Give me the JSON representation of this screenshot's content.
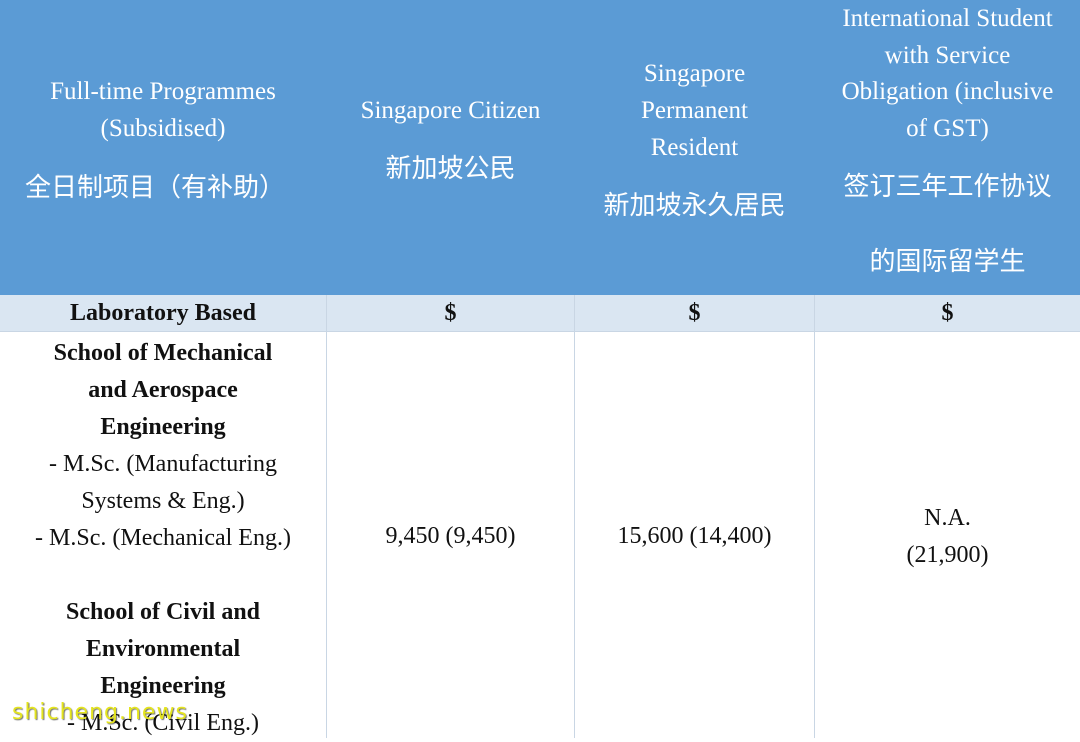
{
  "header": {
    "col1": {
      "en1": "Full-time Programmes",
      "en2": "(Subsidised)",
      "zh": "全日制项目（有补助）"
    },
    "col2": {
      "en": "Singapore Citizen",
      "zh": "新加坡公民"
    },
    "col3": {
      "en1": "Singapore",
      "en2": "Permanent",
      "en3": "Resident",
      "zh": "新加坡永久居民"
    },
    "col4": {
      "en1": "International Student",
      "en2": "with Service",
      "en3": "Obligation (inclusive",
      "en4": "of GST)",
      "zh1": "签订三年工作协议",
      "zh2": "的国际留学生"
    }
  },
  "subheader": {
    "category": "Laboratory Based",
    "c2": "$",
    "c3": "$",
    "c4": "$"
  },
  "programmes": {
    "mae_1": "School of Mechanical",
    "mae_2": "and Aerospace",
    "mae_3": "Engineering",
    "p1_1": "- M.Sc. (Manufacturing",
    "p1_2": "Systems & Eng.)",
    "p2": "- M.Sc. (Mechanical Eng.)",
    "cee_1": "School of Civil and",
    "cee_2": "Environmental",
    "cee_3": "Engineering",
    "p3": "- M.Sc. (Civil Eng.)"
  },
  "fees": {
    "citizen": "9,450 (9,450)",
    "pr": "15,600 (14,400)",
    "intl_1": "N.A.",
    "intl_2": "(21,900)"
  },
  "watermark": "shicheng.news",
  "colors": {
    "header_bg": "#5b9bd5",
    "subheader_bg": "#dae6f2",
    "header_text": "#ffffff"
  }
}
